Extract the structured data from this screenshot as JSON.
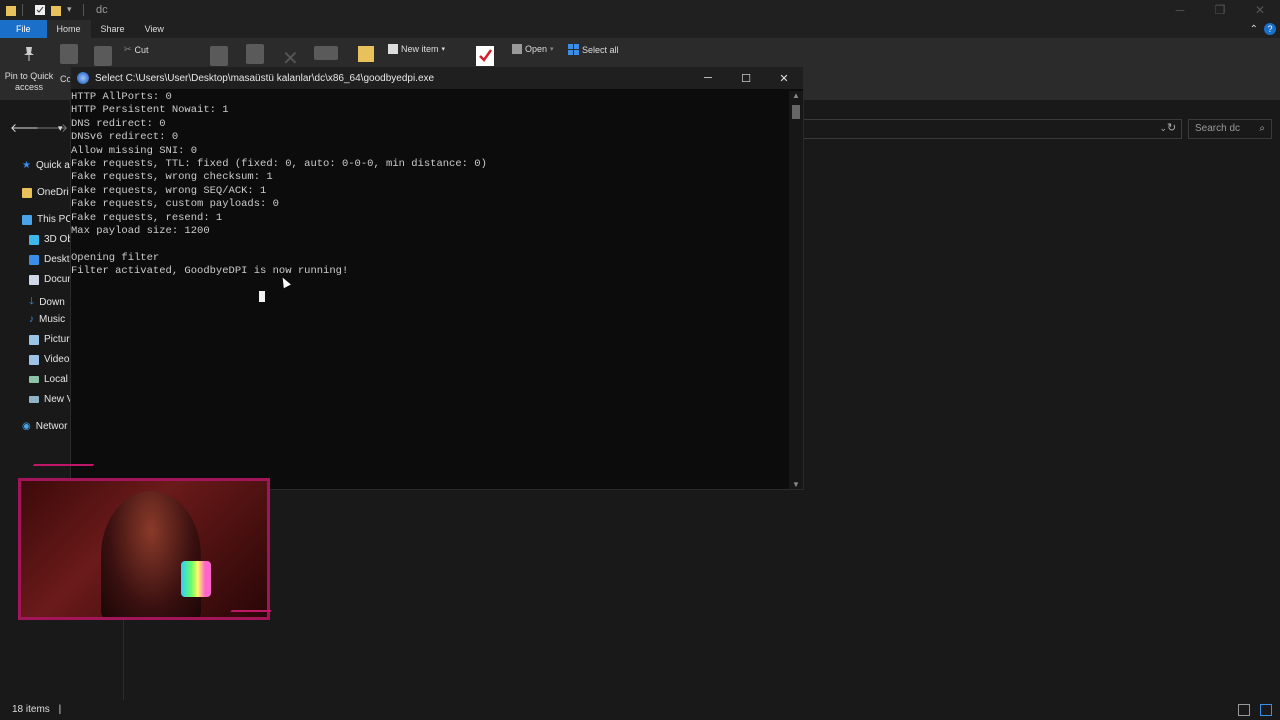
{
  "explorer": {
    "title": "dc",
    "tabs": [
      "File",
      "Home",
      "Share",
      "View"
    ],
    "ribbon": {
      "pin_label_line1": "Pin to Quick",
      "pin_label_line2": "access",
      "copy_label_fragment": "Co",
      "cut_label": "Cut",
      "new_item_label": "New item",
      "open_label": "Open",
      "select_all_label": "Select all"
    },
    "search_placeholder": "Search dc",
    "nav_items": [
      {
        "label": "Quick a",
        "icon": "star-icon",
        "color": "#3a8ee6"
      },
      {
        "label": "OneDri",
        "icon": "folder-icon",
        "color": "#e8c15a"
      },
      {
        "label": "This PC",
        "icon": "computer-icon",
        "color": "#4aa3e8"
      },
      {
        "label": "3D Ob",
        "icon": "cube-icon",
        "color": "#3fb7e8"
      },
      {
        "label": "Deskto",
        "icon": "desktop-icon",
        "color": "#3a8ee6"
      },
      {
        "label": "Docum",
        "icon": "document-icon",
        "color": "#cfd8e6"
      },
      {
        "label": "Down",
        "icon": "download-icon",
        "color": "#3a8ee6"
      },
      {
        "label": "Music",
        "icon": "music-icon",
        "color": "#3a8ee6"
      },
      {
        "label": "Picture",
        "icon": "picture-icon",
        "color": "#9ac3e6"
      },
      {
        "label": "Video",
        "icon": "video-icon",
        "color": "#9ac3e6"
      },
      {
        "label": "Local",
        "icon": "drive-icon",
        "color": "#8fc3a8"
      },
      {
        "label": "New V",
        "icon": "drive-icon",
        "color": "#8fb3c8"
      },
      {
        "label": "Networ",
        "icon": "network-icon",
        "color": "#4aa3e8"
      }
    ],
    "status_text": "18 items"
  },
  "console": {
    "title": "Select C:\\Users\\User\\Desktop\\masaüstü kalanlar\\dc\\x86_64\\goodbyedpi.exe",
    "lines": [
      "HTTP AllPorts: 0",
      "HTTP Persistent Nowait: 1",
      "DNS redirect: 0",
      "DNSv6 redirect: 0",
      "Allow missing SNI: 0",
      "Fake requests, TTL: fixed (fixed: 0, auto: 0-0-0, min distance: 0)",
      "Fake requests, wrong checksum: 1",
      "Fake requests, wrong SEQ/ACK: 1",
      "Fake requests, custom payloads: 0",
      "Fake requests, resend: 1",
      "Max payload size: 1200",
      "",
      "Opening filter",
      "Filter activated, GoodbyeDPI is now running!"
    ]
  },
  "colors": {
    "file_tab": "#1a6fc9",
    "console_bg": "#0c0c0c",
    "console_text": "#cccccc",
    "cam_border": "#a3155a"
  }
}
